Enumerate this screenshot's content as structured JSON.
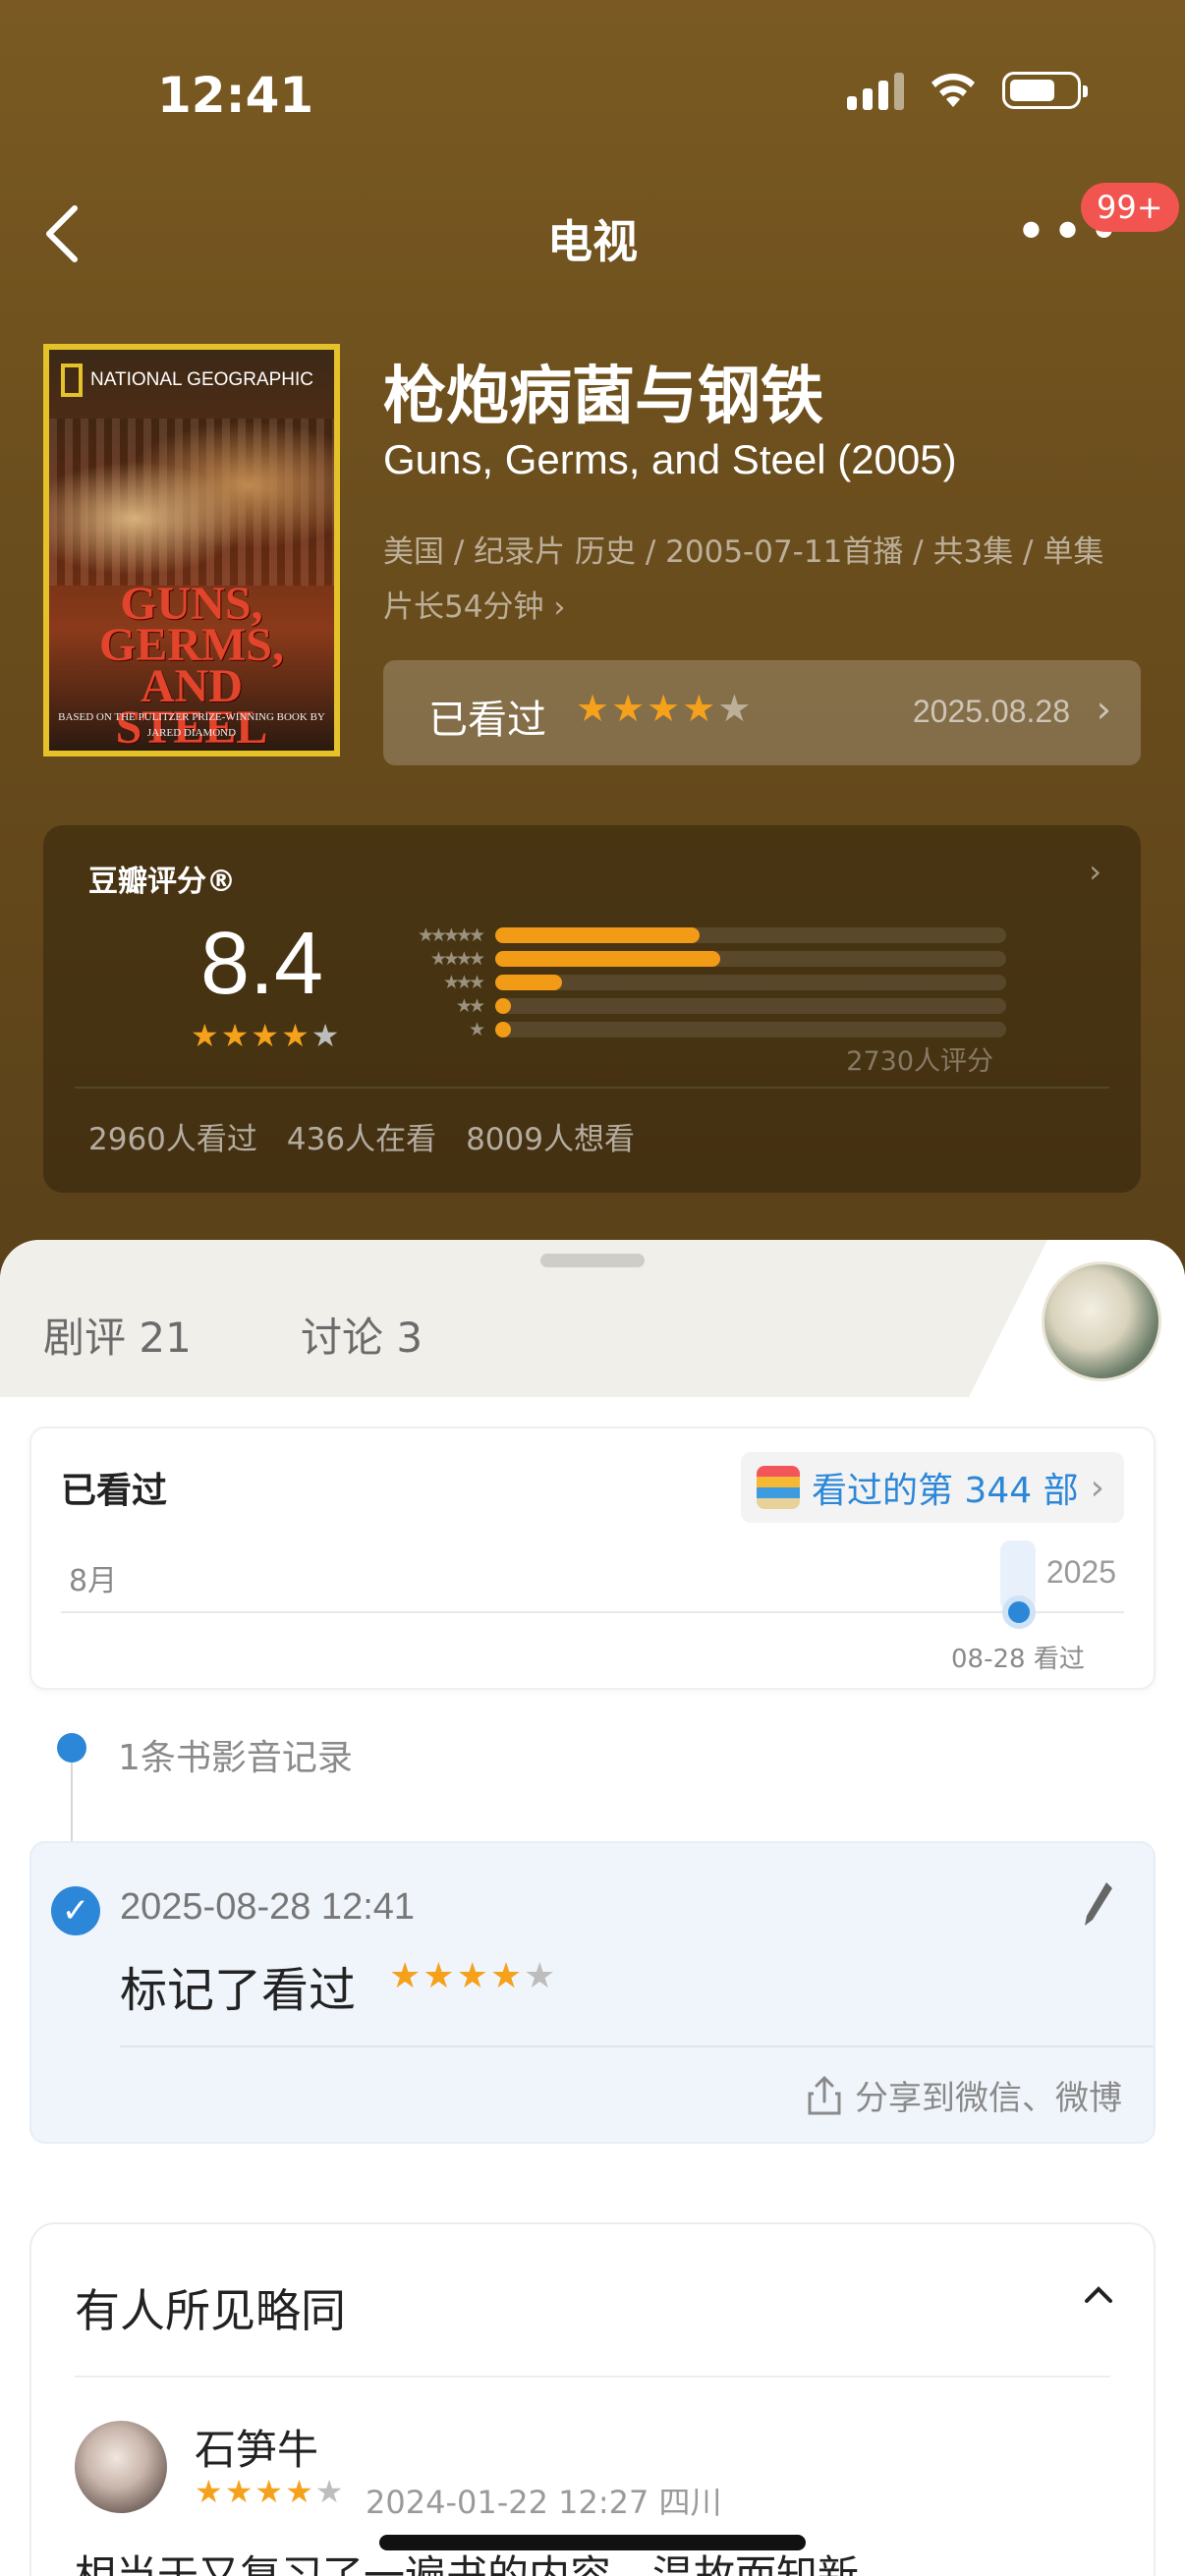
{
  "status_bar": {
    "time": "12:41"
  },
  "nav": {
    "title": "电视",
    "badge": "99+"
  },
  "movie": {
    "title_cn": "枪炮病菌与钢铁",
    "title_en": "Guns, Germs, and Steel (2005)",
    "meta_line1": "美国 / 纪录片 历史 / 2005-07-11首播 / 共3集 / 单集",
    "meta_line2": "片长54分钟",
    "poster": {
      "brand": "NATIONAL GEOGRAPHIC",
      "title": "GUNS, GERMS, AND STEEL",
      "subtitle": "BASED ON THE PULITZER PRIZE-WINNING BOOK BY JARED DIAMOND"
    }
  },
  "watched_button": {
    "label": "已看过",
    "rating": 4,
    "date": "2025.08.28"
  },
  "douban_rating": {
    "label": "豆瓣评分®",
    "score": "8.4",
    "stars": 4,
    "distribution": [
      {
        "stars": 5,
        "percent": 40
      },
      {
        "stars": 4,
        "percent": 44
      },
      {
        "stars": 3,
        "percent": 13
      },
      {
        "stars": 2,
        "percent": 3
      },
      {
        "stars": 1,
        "percent": 3
      }
    ],
    "rating_count": "2730人评分",
    "stats": [
      "2960人看过",
      "436人在看",
      "8009人想看"
    ]
  },
  "tabs": [
    {
      "label": "剧评 21"
    },
    {
      "label": "讨论 3"
    }
  ],
  "watched_card": {
    "title": "已看过",
    "pill_text": "看过的第 344 部",
    "month": "8月",
    "year": "2025",
    "marker_label": "08-28 看过"
  },
  "timeline": {
    "records_label": "1条书影音记录",
    "record": {
      "timestamp": "2025-08-28 12:41",
      "action": "标记了看过",
      "rating": 4,
      "share": "分享到微信、微博"
    }
  },
  "similar": {
    "title": "有人所见略同",
    "review": {
      "user": "石笋牛",
      "rating": 4,
      "meta": "2024-01-22 12:27 四川",
      "text": "相当于又复习了一遍书的内容，温故而知新"
    }
  },
  "colors": {
    "accent_blue": "#2c87d8",
    "star_orange": "#f5a11b",
    "hero_brown": "#6b4e1d"
  }
}
